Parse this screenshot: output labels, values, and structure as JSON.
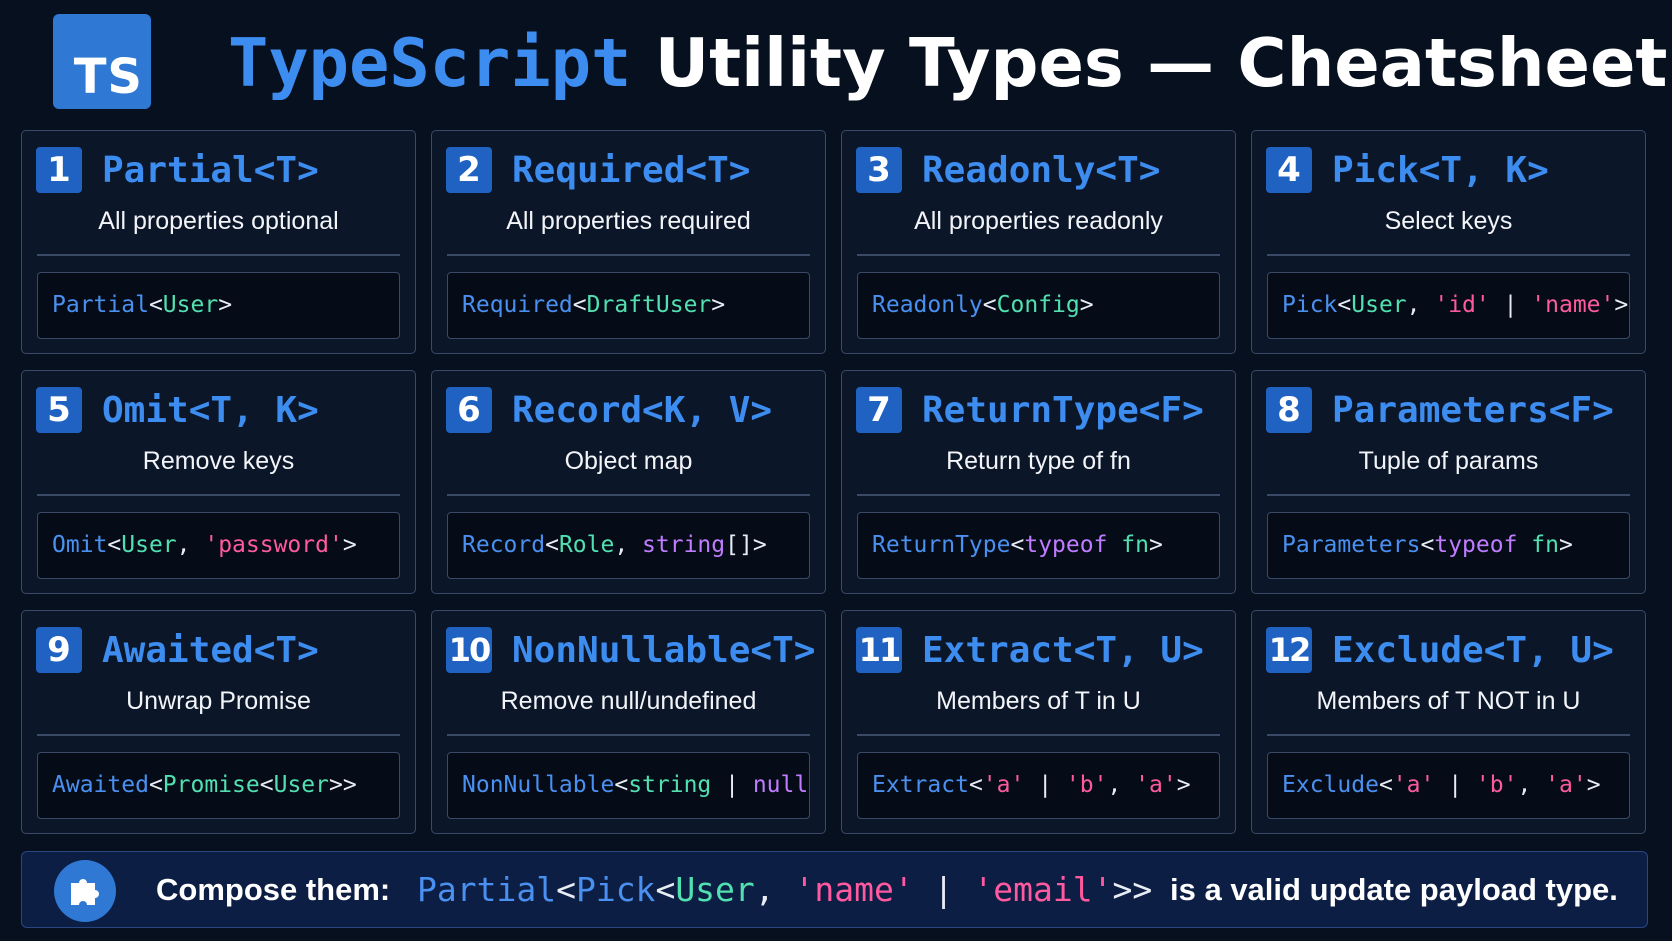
{
  "header": {
    "logo_text": "TS",
    "title_highlight": "TypeScript",
    "title_rest": " Utility Types — Cheatsheet"
  },
  "cards": [
    {
      "num": "1",
      "name": "Partial<T>",
      "desc": "All properties optional",
      "code": [
        {
          "t": "Partial",
          "c": "kw"
        },
        {
          "t": "<",
          "c": "pu"
        },
        {
          "t": "User",
          "c": "ty"
        },
        {
          "t": ">",
          "c": "pu"
        }
      ]
    },
    {
      "num": "2",
      "name": "Required<T>",
      "desc": "All properties required",
      "code": [
        {
          "t": "Required",
          "c": "kw"
        },
        {
          "t": "<",
          "c": "pu"
        },
        {
          "t": "DraftUser",
          "c": "ty"
        },
        {
          "t": ">",
          "c": "pu"
        }
      ]
    },
    {
      "num": "3",
      "name": "Readonly<T>",
      "desc": "All properties readonly",
      "code": [
        {
          "t": "Readonly",
          "c": "kw"
        },
        {
          "t": "<",
          "c": "pu"
        },
        {
          "t": "Config",
          "c": "ty"
        },
        {
          "t": ">",
          "c": "pu"
        }
      ]
    },
    {
      "num": "4",
      "name": "Pick<T, K>",
      "desc": "Select keys",
      "code": [
        {
          "t": "Pick",
          "c": "kw"
        },
        {
          "t": "<",
          "c": "pu"
        },
        {
          "t": "User",
          "c": "ty"
        },
        {
          "t": ", ",
          "c": "pu"
        },
        {
          "t": "'id'",
          "c": "st"
        },
        {
          "t": " | ",
          "c": "pu"
        },
        {
          "t": "'name'",
          "c": "st"
        },
        {
          "t": ">",
          "c": "pu"
        }
      ]
    },
    {
      "num": "5",
      "name": "Omit<T, K>",
      "desc": "Remove keys",
      "code": [
        {
          "t": "Omit",
          "c": "kw"
        },
        {
          "t": "<",
          "c": "pu"
        },
        {
          "t": "User",
          "c": "ty"
        },
        {
          "t": ", ",
          "c": "pu"
        },
        {
          "t": "'password'",
          "c": "st"
        },
        {
          "t": ">",
          "c": "pu"
        }
      ]
    },
    {
      "num": "6",
      "name": "Record<K, V>",
      "desc": "Object map",
      "code": [
        {
          "t": "Record",
          "c": "kw"
        },
        {
          "t": "<",
          "c": "pu"
        },
        {
          "t": "Role",
          "c": "ty"
        },
        {
          "t": ", ",
          "c": "pu"
        },
        {
          "t": "string",
          "c": "pr"
        },
        {
          "t": "[]>",
          "c": "pu"
        }
      ]
    },
    {
      "num": "7",
      "name": "ReturnType<F>",
      "desc": "Return type of fn",
      "code": [
        {
          "t": "ReturnType",
          "c": "kw"
        },
        {
          "t": "<",
          "c": "pu"
        },
        {
          "t": "typeof",
          "c": "pr"
        },
        {
          "t": " fn",
          "c": "ty"
        },
        {
          "t": ">",
          "c": "pu"
        }
      ]
    },
    {
      "num": "8",
      "name": "Parameters<F>",
      "desc": "Tuple of params",
      "code": [
        {
          "t": "Parameters",
          "c": "kw"
        },
        {
          "t": "<",
          "c": "pu"
        },
        {
          "t": "typeof",
          "c": "pr"
        },
        {
          "t": " fn",
          "c": "ty"
        },
        {
          "t": ">",
          "c": "pu"
        }
      ]
    },
    {
      "num": "9",
      "name": "Awaited<T>",
      "desc": "Unwrap Promise",
      "code": [
        {
          "t": "Awaited",
          "c": "kw"
        },
        {
          "t": "<",
          "c": "pu"
        },
        {
          "t": "Promise",
          "c": "ty"
        },
        {
          "t": "<",
          "c": "pu"
        },
        {
          "t": "User",
          "c": "ty"
        },
        {
          "t": ">>",
          "c": "pu"
        }
      ]
    },
    {
      "num": "10",
      "name": "NonNullable<T>",
      "desc": "Remove null/undefined",
      "code": [
        {
          "t": "NonNullable",
          "c": "kw"
        },
        {
          "t": "<",
          "c": "pu"
        },
        {
          "t": "string",
          "c": "ty"
        },
        {
          "t": " | ",
          "c": "pu"
        },
        {
          "t": "null",
          "c": "pr"
        },
        {
          "t": ">",
          "c": "pu"
        }
      ]
    },
    {
      "num": "11",
      "name": "Extract<T, U>",
      "desc": "Members of T in U",
      "code": [
        {
          "t": "Extract",
          "c": "kw"
        },
        {
          "t": "<",
          "c": "pu"
        },
        {
          "t": "'a'",
          "c": "st"
        },
        {
          "t": " | ",
          "c": "pu"
        },
        {
          "t": "'b'",
          "c": "st"
        },
        {
          "t": ", ",
          "c": "pu"
        },
        {
          "t": "'a'",
          "c": "st"
        },
        {
          "t": ">",
          "c": "pu"
        }
      ]
    },
    {
      "num": "12",
      "name": "Exclude<T, U>",
      "desc": "Members of T NOT in U",
      "code": [
        {
          "t": "Exclude",
          "c": "kw"
        },
        {
          "t": "<",
          "c": "pu"
        },
        {
          "t": "'a'",
          "c": "st"
        },
        {
          "t": " | ",
          "c": "pu"
        },
        {
          "t": "'b'",
          "c": "st"
        },
        {
          "t": ", ",
          "c": "pu"
        },
        {
          "t": "'a'",
          "c": "st"
        },
        {
          "t": ">",
          "c": "pu"
        }
      ]
    }
  ],
  "footer": {
    "icon": "puzzle-icon",
    "label": "Compose them:",
    "code": [
      {
        "t": "Partial",
        "c": "kw"
      },
      {
        "t": "<",
        "c": "pu"
      },
      {
        "t": "Pick",
        "c": "kw"
      },
      {
        "t": "<",
        "c": "pu"
      },
      {
        "t": "User",
        "c": "ty"
      },
      {
        "t": ", ",
        "c": "pu"
      },
      {
        "t": "'name'",
        "c": "st"
      },
      {
        "t": " | ",
        "c": "pu"
      },
      {
        "t": "'email'",
        "c": "st"
      },
      {
        "t": ">>",
        "c": "pu"
      }
    ],
    "tail": "is a valid update payload type."
  },
  "colors": {
    "background": "#07101f",
    "accent_blue": "#3d8cf0",
    "type_green": "#52e0b0",
    "string_pink": "#ff5aa0",
    "keyword_purple": "#c07cff"
  }
}
